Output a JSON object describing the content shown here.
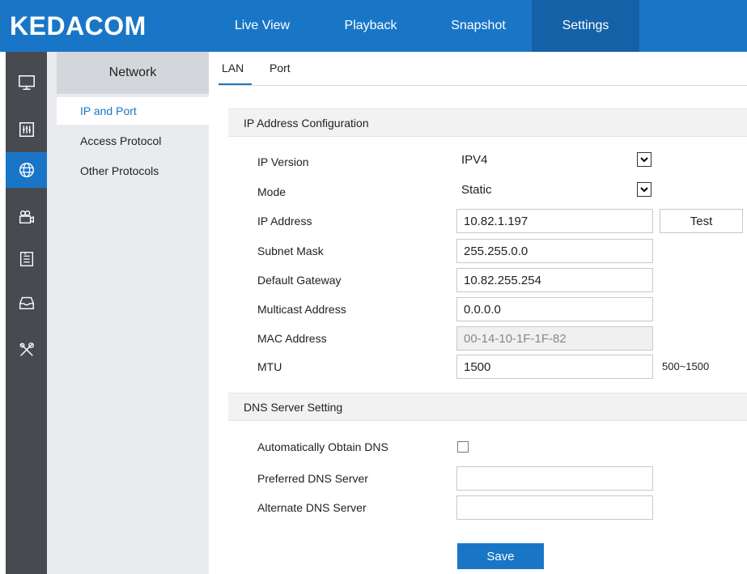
{
  "app": {
    "logo": "KEDACOM"
  },
  "nav": {
    "items": [
      {
        "label": "Live View"
      },
      {
        "label": "Playback"
      },
      {
        "label": "Snapshot"
      },
      {
        "label": "Settings"
      }
    ],
    "active": "Settings"
  },
  "rail": {
    "icons": [
      "monitor-icon",
      "equalizer-icon",
      "network-globe-icon",
      "camera-icon",
      "clipboard-icon",
      "inbox-icon",
      "tools-icon"
    ],
    "active": "network-globe-icon"
  },
  "submenu": {
    "title": "Network",
    "items": [
      {
        "label": "IP and Port"
      },
      {
        "label": "Access Protocol"
      },
      {
        "label": "Other Protocols"
      }
    ],
    "active": "IP and Port"
  },
  "tabs": {
    "items": [
      {
        "label": "LAN"
      },
      {
        "label": "Port"
      }
    ],
    "active": "LAN"
  },
  "ip_config": {
    "header": "IP Address Configuration",
    "ip_version": {
      "label": "IP Version",
      "value": "IPV4"
    },
    "mode": {
      "label": "Mode",
      "value": "Static"
    },
    "ip_address": {
      "label": "IP Address",
      "value": "10.82.1.197",
      "test_label": "Test"
    },
    "subnet_mask": {
      "label": "Subnet Mask",
      "value": "255.255.0.0"
    },
    "default_gateway": {
      "label": "Default Gateway",
      "value": "10.82.255.254"
    },
    "multicast_address": {
      "label": "Multicast Address",
      "value": "0.0.0.0"
    },
    "mac_address": {
      "label": "MAC Address",
      "value": "00-14-10-1F-1F-82"
    },
    "mtu": {
      "label": "MTU",
      "value": "1500",
      "range": "500~1500"
    }
  },
  "dns": {
    "header": "DNS Server Setting",
    "auto": {
      "label": "Automatically Obtain DNS",
      "checked": false
    },
    "preferred": {
      "label": "Preferred DNS Server",
      "value": ""
    },
    "alternate": {
      "label": "Alternate DNS Server",
      "value": ""
    }
  },
  "actions": {
    "save_label": "Save"
  },
  "colors": {
    "accent": "#1976c7",
    "rail": "#474b51",
    "submenu": "#e9ebee"
  }
}
